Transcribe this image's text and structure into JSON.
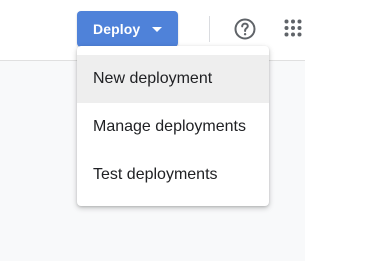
{
  "toolbar": {
    "deploy_label": "Deploy",
    "deploy_color": "#4f82d9",
    "caret_icon": "caret-down-icon",
    "help_icon": "help-circle-icon",
    "apps_icon": "apps-grid-icon"
  },
  "deploy_menu": {
    "items": [
      {
        "label": "New deployment",
        "highlighted": true
      },
      {
        "label": "Manage deployments",
        "highlighted": false
      },
      {
        "label": "Test deployments",
        "highlighted": false
      }
    ]
  }
}
